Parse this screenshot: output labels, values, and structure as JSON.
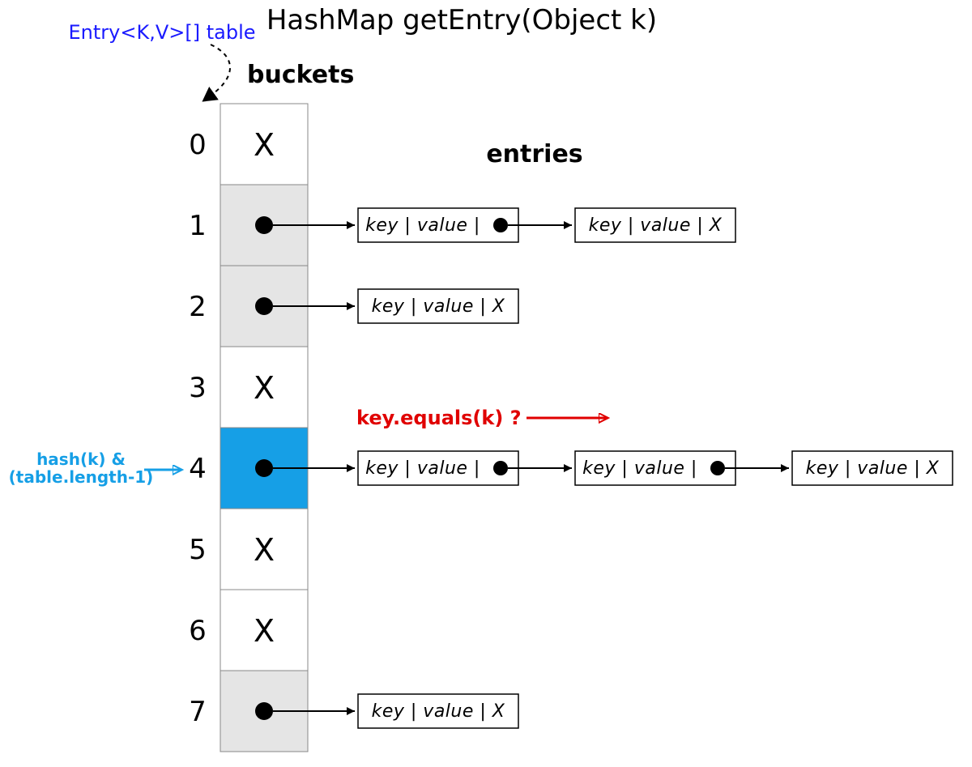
{
  "title": "HashMap getEntry(Object k)",
  "tableLabel": "Entry<K,V>[] table",
  "bucketsLabel": "buckets",
  "entriesLabel": "entries",
  "hashLabel1": "hash(k) &",
  "hashLabel2": "(table.length-1)",
  "equalsLabel": "key.equals(k) ?",
  "indices": [
    "0",
    "1",
    "2",
    "3",
    "4",
    "5",
    "6",
    "7"
  ],
  "bucketX": "X",
  "buckets": [
    {
      "type": "x"
    },
    {
      "type": "dot"
    },
    {
      "type": "dot"
    },
    {
      "type": "x"
    },
    {
      "type": "dot",
      "highlight": true
    },
    {
      "type": "x"
    },
    {
      "type": "x"
    },
    {
      "type": "dot"
    }
  ],
  "entryKV": "key | value |",
  "entryKVX": "key | value |  X",
  "chains": {
    "1": 2,
    "2": 1,
    "4": 3,
    "7": 1
  },
  "colors": {
    "highlight": "#169fe6",
    "zebra": "#e5e5e5",
    "box": "#000000"
  }
}
